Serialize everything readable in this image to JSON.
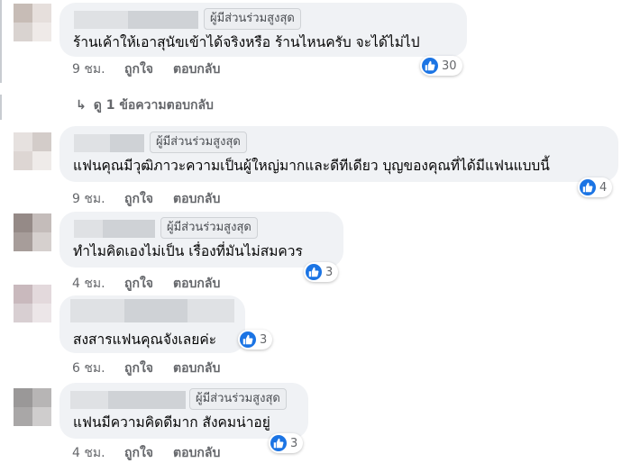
{
  "comments": [
    {
      "badge": "ผู้มีส่วนร่วมสูงสุด",
      "text": "ร้านเค้าให้เอาสุนัขเข้าได้จริงหรือ ร้านไหนครับ จะได้ไม่ไป",
      "reactions": "30",
      "time": "9 ชม.",
      "like_label": "ถูกใจ",
      "reply_label": "ตอบกลับ",
      "view_replies": "ดู 1 ข้อความตอบกลับ"
    },
    {
      "badge": "ผู้มีส่วนร่วมสูงสุด",
      "text": "แฟนคุณมีวุฒิภาวะความเป็นผู้ใหญ่มากและดีทีเดียว บุญของคุณที่ได้มีแฟนแบบนี้",
      "reactions": "4",
      "time": "9 ชม.",
      "like_label": "ถูกใจ",
      "reply_label": "ตอบกลับ"
    },
    {
      "badge": "ผู้มีส่วนร่วมสูงสุด",
      "text": "ทำไมคิดเองไม่เป็น เรื่องที่มันไม่สมควร",
      "reactions": "3",
      "time": "4 ชม.",
      "like_label": "ถูกใจ",
      "reply_label": "ตอบกลับ"
    },
    {
      "text": "สงสารแฟนคุณจังเลยค่ะ",
      "reactions": "3",
      "time": "6 ชม.",
      "like_label": "ถูกใจ",
      "reply_label": "ตอบกลับ"
    },
    {
      "badge": "ผู้มีส่วนร่วมสูงสุด",
      "text": "แฟนมีความคิดดีมาก สังคมน่าอยู่",
      "reactions": "3",
      "time": "4 ชม.",
      "like_label": "ถูกใจ",
      "reply_label": "ตอบกลับ"
    }
  ],
  "colors": {
    "bubble": "#f0f2f5",
    "like_blue": "#1b74e4",
    "meta_gray": "#65676b"
  }
}
